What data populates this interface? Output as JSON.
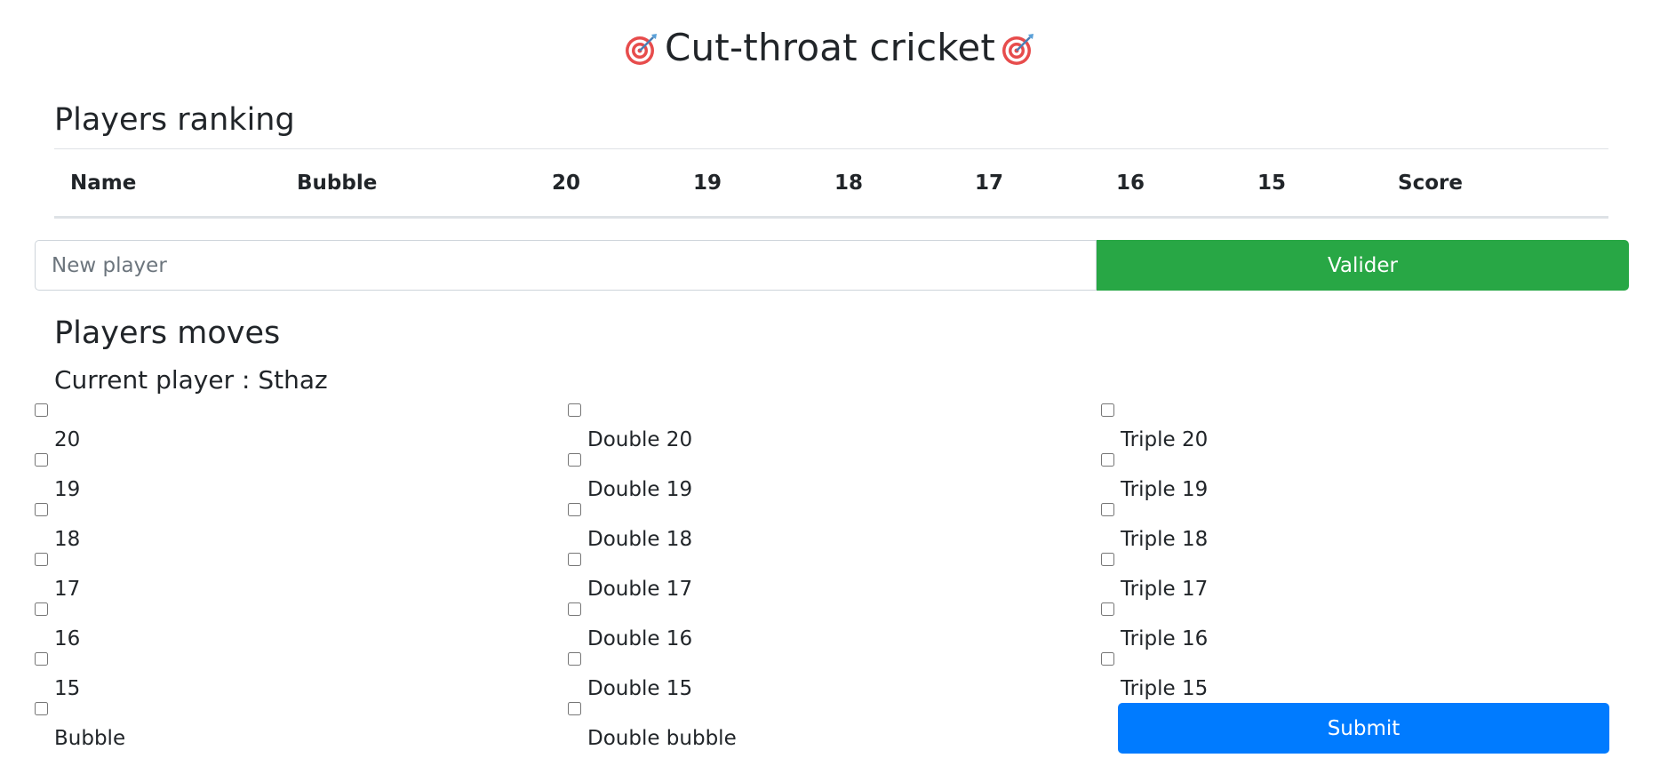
{
  "header": {
    "title": "Cut-throat cricket",
    "icon": "direct-hit-target-icon"
  },
  "ranking": {
    "heading": "Players ranking",
    "columns": [
      "Name",
      "Bubble",
      "20",
      "19",
      "18",
      "17",
      "16",
      "15",
      "Score"
    ]
  },
  "new_player": {
    "placeholder": "New player",
    "value": "",
    "button_label": "Valider"
  },
  "moves": {
    "heading": "Players moves",
    "current_player_label": "Current player : ",
    "current_player": "Sthaz",
    "singles": [
      "20",
      "19",
      "18",
      "17",
      "16",
      "15",
      "Bubble"
    ],
    "doubles": [
      "Double 20",
      "Double 19",
      "Double 18",
      "Double 17",
      "Double 16",
      "Double 15",
      "Double bubble"
    ],
    "triples": [
      "Triple 20",
      "Triple 19",
      "Triple 18",
      "Triple 17",
      "Triple 16",
      "Triple 15"
    ],
    "submit_label": "Submit"
  },
  "colors": {
    "success": "#28a745",
    "primary": "#007bff",
    "text": "#212529",
    "border": "#dee2e6"
  }
}
